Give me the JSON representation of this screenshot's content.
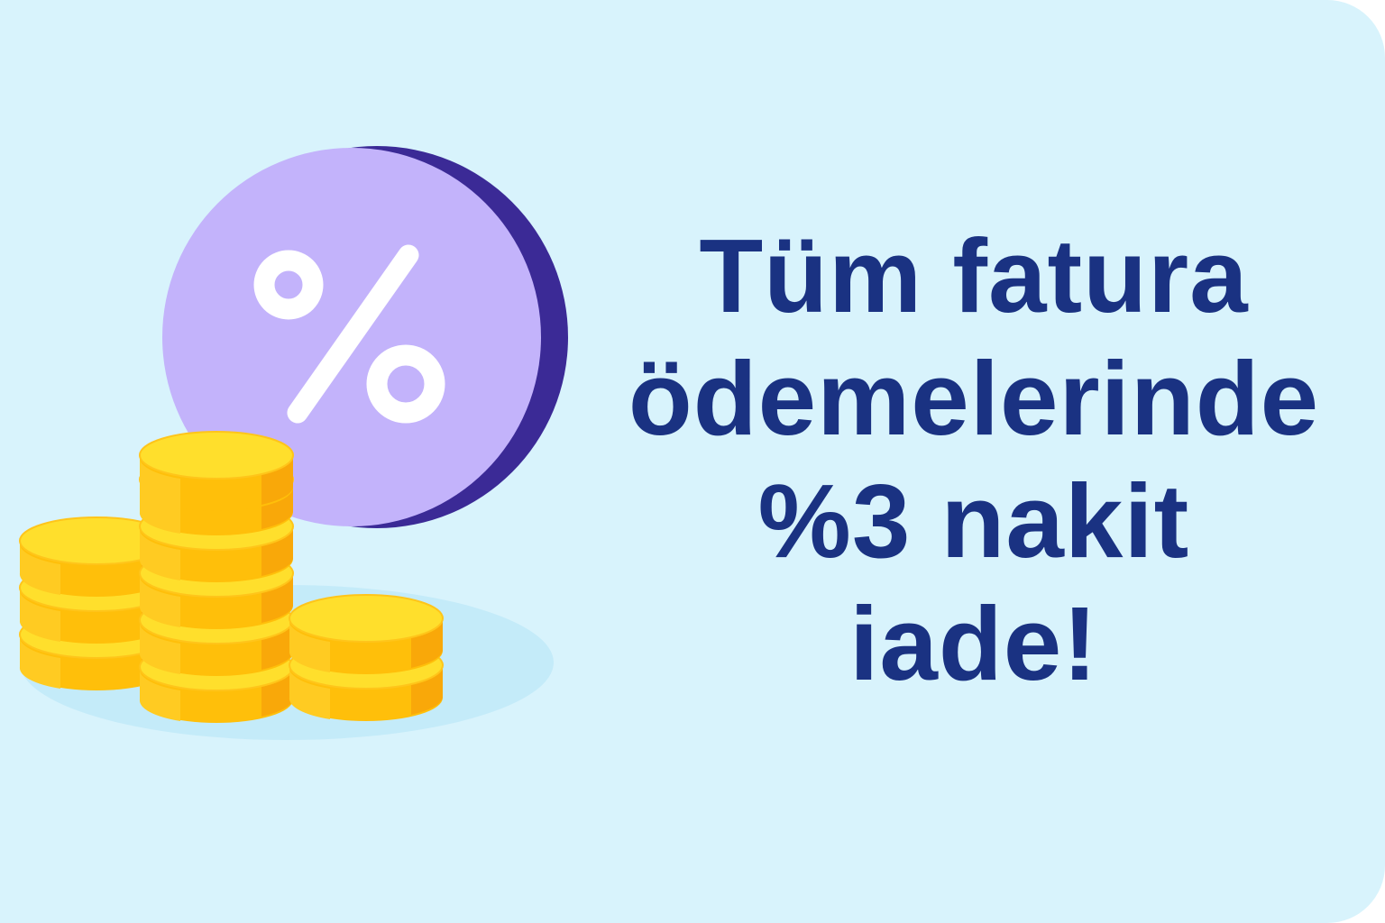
{
  "headline": {
    "lines": [
      "Tüm fatura",
      "ödemelerinde",
      "%3 nakit",
      "iade!"
    ]
  },
  "illustration": {
    "badge_icon": "percent-icon",
    "coins_icon": "coin-stack-icon"
  },
  "colors": {
    "background": "#d8f3fc",
    "headline": "#1a3282",
    "badge_face": "#c3b3fb",
    "badge_edge": "#3b2a96",
    "coin_face": "#ffdf2c",
    "coin_side": "#ffbf0a"
  }
}
